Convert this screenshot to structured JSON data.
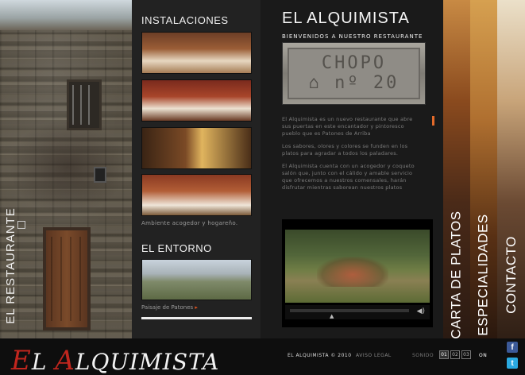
{
  "left": {
    "vertical_label": "EL RESTAURANTE"
  },
  "instalaciones": {
    "title": "INSTALACIONES",
    "caption": "Ambiente acogedor y hogareño."
  },
  "entorno": {
    "title": "EL ENTORNO",
    "caption": "Paisaje de Patones",
    "caption_arrow": "▸"
  },
  "main": {
    "title": "EL ALQUIMISTA",
    "subtitle": "BIENVENIDOS A NUESTRO RESTAURANTE",
    "sign_line1": "CHOPO",
    "sign_line2": "⌂ nº 20",
    "paragraphs": [
      "El Alquimista es un nuevo restaurante que abre sus puertas en este encantador y pintoresco pueblo que es Patones de Arriba",
      "Los sabores, olores y colores se funden en los platos para agradar a todos los paladares.",
      "El Alquimista cuenta con un acogedor y coqueto salón que, junto con el cálido y amable servicio que ofrecemos a nuestros comensales, harán disfrutar mientras saborean nuestros platos"
    ],
    "video_play": "▲",
    "video_volume": "◀)"
  },
  "nav": {
    "carta": "CARTA DE PLATOS",
    "especialidades": "ESPECIALIDADES",
    "contacto": "CONTACTO"
  },
  "footer": {
    "logo_first_cap": "E",
    "logo_first_rest": "L ",
    "logo_second_cap": "A",
    "logo_second_rest": "LQUIMISTA",
    "copyright": "EL ALQUIMISTA © 2010",
    "legal": "AVISO LEGAL",
    "sound_label": "SONIDO",
    "sound_tracks": [
      "01",
      "02",
      "03"
    ],
    "sound_state": "ON",
    "facebook": "f",
    "twitter": "t"
  },
  "colors": {
    "accent": "#e36a2a",
    "logo_red": "#c0261e",
    "facebook": "#3b5998",
    "twitter": "#2aa9e0"
  }
}
